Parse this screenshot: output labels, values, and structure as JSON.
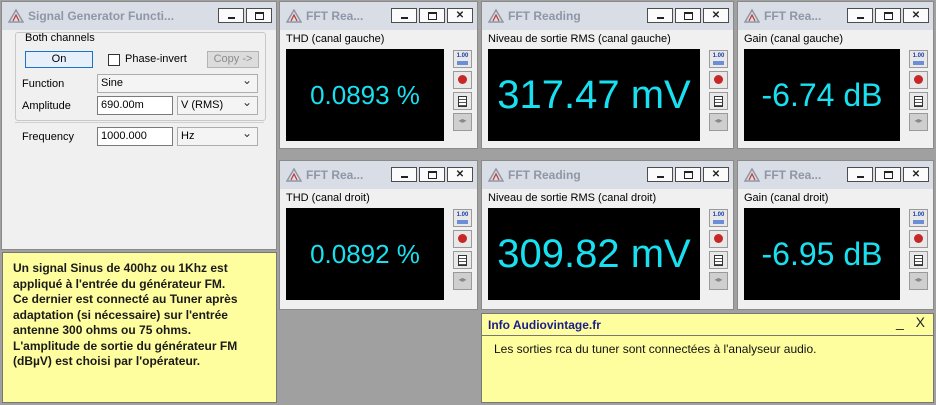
{
  "signal_generator": {
    "title": "Signal Generator Functi...",
    "channels_label": "Both channels",
    "on_button": "On",
    "phase_invert_label": "Phase-invert",
    "copy_button": "Copy ->",
    "function_label": "Function",
    "function_value": "Sine",
    "amplitude_label": "Amplitude",
    "amplitude_value": "690.00m",
    "amplitude_unit": "V (RMS)",
    "frequency_label": "Frequency",
    "frequency_value": "1000.000",
    "frequency_unit": "Hz"
  },
  "fft_windows": [
    {
      "title": "FFT Rea...",
      "subtitle": "THD (canal gauche)",
      "value": "0.0893 %"
    },
    {
      "title": "FFT Reading",
      "subtitle": "Niveau de sortie RMS  (canal gauche)",
      "value": "317.47 mV"
    },
    {
      "title": "FFT Rea...",
      "subtitle": "Gain (canal gauche)",
      "value": "-6.74 dB"
    },
    {
      "title": "FFT Rea...",
      "subtitle": "THD (canal droit)",
      "value": "0.0892 %"
    },
    {
      "title": "FFT Reading",
      "subtitle": "Niveau de sortie RMS (canal droit)",
      "value": "309.82 mV"
    },
    {
      "title": "FFT Rea...",
      "subtitle": "Gain (canal droit)",
      "value": "-6.95 dB"
    }
  ],
  "note_left": {
    "text": "Un signal Sinus de 400hz ou 1Khz  est appliqué à l'entrée du générateur FM.\nCe dernier est connecté au Tuner après adaptation (si nécessaire) sur l'entrée antenne 300 ohms ou 75 ohms.\nL'amplitude de sortie du générateur FM (dBµV) est choisi par l'opérateur."
  },
  "note_right": {
    "title": "Info Audiovintage.fr",
    "controls": "_ X",
    "text": "Les sorties rca du tuner sont connectées à l'analyseur audio."
  },
  "colors": {
    "readout": "#19e0f0",
    "screen_bg": "#000000",
    "note_bg": "#fffe9e",
    "title_text": "#8f97a6"
  },
  "icons": [
    "fft-app-icon",
    "minimize-icon",
    "maximize-icon",
    "close-icon",
    "scale-icon",
    "probe-icon",
    "list-icon",
    "arrows-icon"
  ]
}
